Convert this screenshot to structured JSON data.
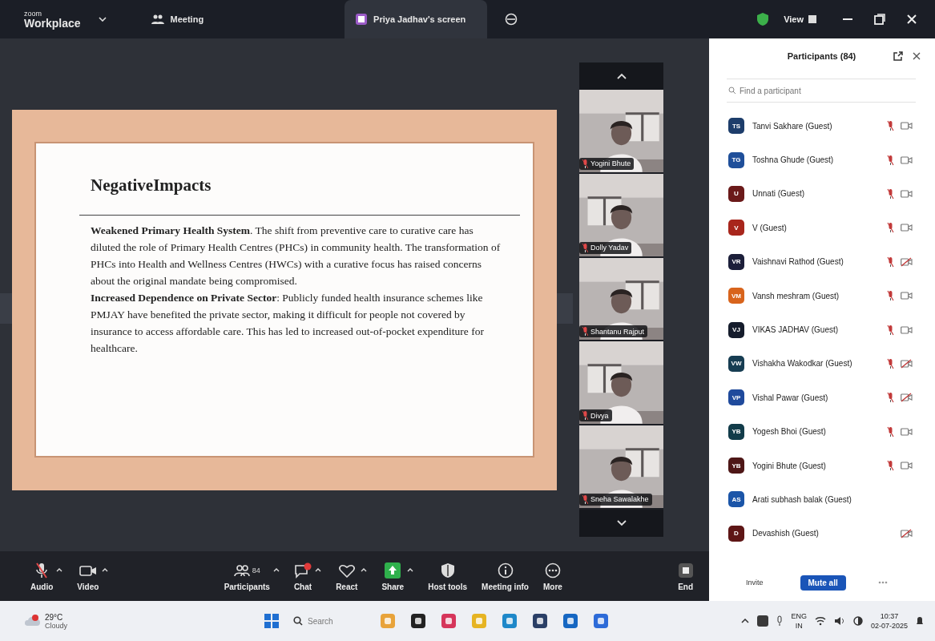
{
  "window": {
    "brand_small": "zoom",
    "brand": "Workplace",
    "tabs": [
      {
        "label": "Meeting",
        "kind": "meeting",
        "selected": false
      },
      {
        "label": "Priya Jadhav's screen",
        "kind": "share",
        "selected": true
      }
    ],
    "view": "View"
  },
  "slide": {
    "title": "NegativeImpacts",
    "paragraphs": [
      "**Weakened Primary Health System**. The shift from preventive care to curative care has diluted the role of Primary Health Centres (PHCs) in community health. The transformation of PHCs into Health and Wellness Centres (HWCs) with a curative focus has raised concerns about the original mandate being compromised.",
      "**Increased Dependence on Private Sector**: Publicly funded health insurance schemes like PMJAY have benefited the private sector, making it difficult for people not covered by insurance to access affordable care. This has led to increased out-of-pocket expenditure for healthcare."
    ]
  },
  "videos": [
    {
      "name": "Yogini Bhute",
      "muted": true
    },
    {
      "name": "Dolly Yadav",
      "muted": true
    },
    {
      "name": "Shantanu Rajput",
      "muted": true
    },
    {
      "name": "Divya",
      "muted": true
    },
    {
      "name": "Sneha Sawalakhe",
      "muted": true
    }
  ],
  "toolbar": [
    {
      "label": "Audio",
      "kind": "audio",
      "caret": true
    },
    {
      "label": "Video",
      "kind": "video",
      "caret": true
    },
    {
      "label": "Participants",
      "kind": "participants",
      "caret": true,
      "count": "84"
    },
    {
      "label": "Chat",
      "kind": "chat",
      "caret": true
    },
    {
      "label": "React",
      "kind": "react",
      "caret": true
    },
    {
      "label": "Share",
      "kind": "share",
      "caret": true
    },
    {
      "label": "Host tools",
      "kind": "host",
      "caret": false
    },
    {
      "label": "Meeting info",
      "kind": "info",
      "caret": false
    },
    {
      "label": "More",
      "kind": "more",
      "caret": false
    },
    {
      "label": "End",
      "kind": "end",
      "caret": false
    }
  ],
  "participants": {
    "title": "Participants (84)",
    "search": {
      "placeholder": "Find a participant"
    },
    "items": [
      {
        "initials": "TS",
        "name": "Tanvi Sakhare (Guest)",
        "color": "#1d3d6b",
        "mic_muted": true,
        "video_off": false
      },
      {
        "initials": "TG",
        "name": "Toshna Ghude (Guest)",
        "color": "#1f4f9a",
        "mic_muted": true,
        "video_off": false
      },
      {
        "initials": "U",
        "name": "Unnati (Guest)",
        "color": "#6b1a1a",
        "mic_muted": true,
        "video_off": false
      },
      {
        "initials": "V",
        "name": "V (Guest)",
        "color": "#a8261c",
        "mic_muted": true,
        "video_off": false
      },
      {
        "initials": "VR",
        "name": "Vaishnavi Rathod (Guest)",
        "color": "#1c1f3a",
        "mic_muted": true,
        "video_off": true
      },
      {
        "initials": "VM",
        "name": "Vansh meshram (Guest)",
        "color": "#d8641c",
        "mic_muted": true,
        "video_off": false
      },
      {
        "initials": "VJ",
        "name": "VIKAS JADHAV (Guest)",
        "color": "#151c2c",
        "mic_muted": true,
        "video_off": false
      },
      {
        "initials": "VW",
        "name": "Vishakha Wakodkar (Guest)",
        "color": "#173d52",
        "mic_muted": true,
        "video_off": true
      },
      {
        "initials": "VP",
        "name": "Vishal Pawar (Guest)",
        "color": "#1f4a9c",
        "mic_muted": true,
        "video_off": true
      },
      {
        "initials": "YB",
        "name": "Yogesh Bhoi (Guest)",
        "color": "#123c4a",
        "mic_muted": true,
        "video_off": false
      },
      {
        "initials": "YB",
        "name": "Yogini Bhute (Guest)",
        "color": "#4e1717",
        "mic_muted": true,
        "video_off": false
      },
      {
        "initials": "AS",
        "name": "Arati subhash balak (Guest)",
        "color": "#1b55a8"
      },
      {
        "initials": "D",
        "name": "Devashish (Guest)",
        "color": "#5e1616",
        "video_off": true
      }
    ],
    "invite": "Invite",
    "mute_all": "Mute all"
  },
  "taskbar": {
    "temp": "29°C",
    "weather": "Cloudy",
    "search": "Search",
    "lang": "ENG",
    "region": "IN",
    "time": "10:37",
    "date": "02-07-2025"
  }
}
